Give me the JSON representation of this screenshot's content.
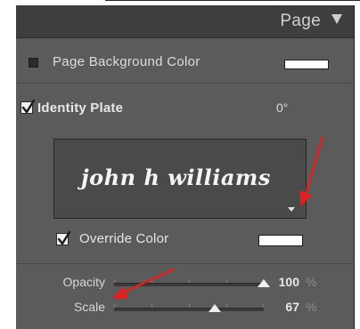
{
  "panel": {
    "title": "Page",
    "collapse_icon": "triangle-down-icon"
  },
  "page_background": {
    "label": "Page Background Color",
    "checked": false,
    "swatch_color": "#ffffff"
  },
  "identity_plate": {
    "label": "Identity Plate",
    "checked": true,
    "angle": "0°",
    "signature_text": "john h williams",
    "menu_icon": "triangle-down-icon"
  },
  "override_color": {
    "label": "Override Color",
    "checked": true,
    "swatch_color": "#ffffff"
  },
  "sliders": {
    "opacity": {
      "label": "Opacity",
      "value": "100",
      "unit": "%",
      "fraction": 1.0
    },
    "scale": {
      "label": "Scale",
      "value": "67",
      "unit": "%",
      "fraction": 0.67
    }
  },
  "annotations": {
    "arrow_color": "#e02020"
  }
}
